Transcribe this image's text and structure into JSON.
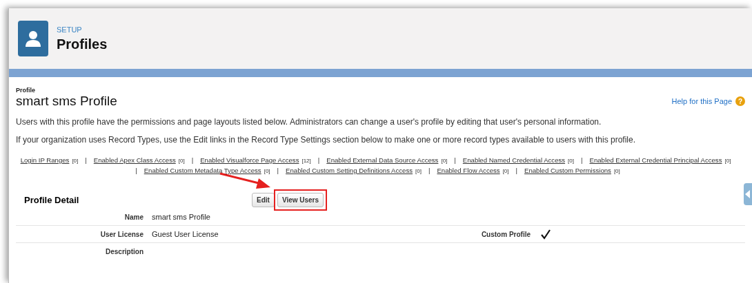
{
  "header": {
    "section": "SETUP",
    "title": "Profiles"
  },
  "page": {
    "type_label": "Profile",
    "title": "smart sms Profile",
    "help_link": "Help for this Page",
    "help_icon": "?"
  },
  "descriptions": [
    "Users with this profile have the permissions and page layouts listed below. Administrators can change a user's profile by editing that user's personal information.",
    "If your organization uses Record Types, use the Edit links in the Record Type Settings section below to make one or more record types available to users with this profile."
  ],
  "related_links": [
    [
      {
        "label": "Login IP Ranges",
        "count": "[0]"
      },
      {
        "separator": "|",
        "label": "Enabled Apex Class Access",
        "count": "[0]"
      },
      {
        "separator": "|",
        "label": "Enabled Visualforce Page Access",
        "count": "[12]"
      },
      {
        "separator": "|",
        "label": "Enabled External Data Source Access",
        "count": "[0]"
      },
      {
        "separator": "|",
        "label": "Enabled Named Credential Access",
        "count": "[0]"
      },
      {
        "separator": "|",
        "label": "Enabled External Credential Principal Access",
        "count": "[0]"
      }
    ],
    [
      {
        "separator": "|",
        "label": "Enabled Custom Metadata Type Access",
        "count": "[0]"
      },
      {
        "separator": "|",
        "label": "Enabled Custom Setting Definitions Access",
        "count": "[0]"
      },
      {
        "separator": "|",
        "label": "Enabled Flow Access",
        "count": "[0]"
      },
      {
        "separator": "|",
        "label": "Enabled Custom Permissions",
        "count": "[0]"
      }
    ]
  ],
  "detail": {
    "title": "Profile Detail",
    "buttons": [
      {
        "label": "Edit",
        "highlighted": false
      },
      {
        "label": "View Users",
        "highlighted": true
      }
    ],
    "rows": [
      {
        "label": "Name",
        "value": "smart sms Profile"
      },
      {
        "label": "User License",
        "value": "Guest User License",
        "extra_label": "Custom Profile",
        "extra_checked": true
      },
      {
        "label": "Description"
      }
    ]
  }
}
